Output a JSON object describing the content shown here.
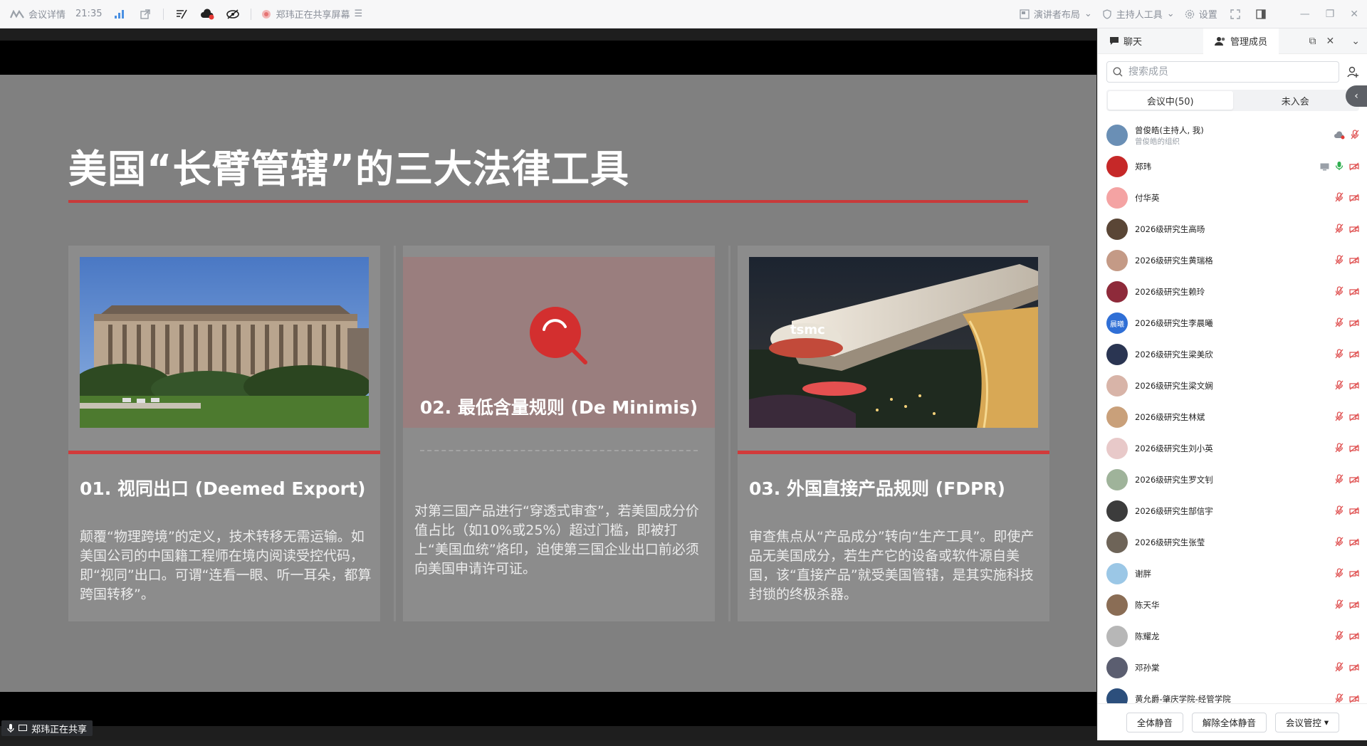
{
  "topbar": {
    "meeting_info_label": "会议详情",
    "time": "21:35",
    "sharing_status": "郑玮正在共享屏幕",
    "layout_label": "演讲者布局",
    "host_tools_label": "主持人工具",
    "settings_label": "设置"
  },
  "slide": {
    "title": "美国“长臂管辖”的三大法律工具",
    "cards": [
      {
        "title": "01. 视同出口 (Deemed Export)",
        "body": "颠覆“物理跨境”的定义，技术转移无需运输。如美国公司的中国籍工程师在境内阅读受控代码，即“视同”出口。可谓“连看一眼、听一耳朵，都算跨国转移”。"
      },
      {
        "title": "02. 最低含量规则 (De Minimis)",
        "body": "对第三国产品进行“穿透式审查”，若美国成分价值占比（如10%或25%）超过门槛，即被打上“美国血统”烙印，迫使第三国企业出口前必须向美国申请许可证。"
      },
      {
        "title": "03. 外国直接产品规则 (FDPR)",
        "body": "审查焦点从“产品成分”转向“生产工具”。即使产品无美国成分，若生产它的设备或软件源自美国，该“直接产品”就受美国管辖，是其实施科技封锁的终极杀器。"
      }
    ],
    "building_sign": "tsmc"
  },
  "share_tag": "郑玮正在共享",
  "panel": {
    "tab_chat": "聊天",
    "tab_members": "管理成员",
    "search_placeholder": "搜索成员",
    "seg_in_meeting": "会议中(50)",
    "seg_not_joined": "未入会",
    "members": [
      {
        "name": "曾俊皓(主持人, 我)",
        "sub": "曾俊皓的组织",
        "color": "#6a8fb5"
      },
      {
        "name": "郑玮",
        "color": "#c62828"
      },
      {
        "name": "付华英",
        "color": "#f4a3a3"
      },
      {
        "name": "2026级研究生高旸",
        "color": "#5a4636"
      },
      {
        "name": "2026级研究生黄瑞格",
        "color": "#c49a86"
      },
      {
        "name": "2026级研究生赖玲",
        "color": "#8e2a3a"
      },
      {
        "name": "2026级研究生李晨曦",
        "initials": "晨曦",
        "color": "#2f6fd6"
      },
      {
        "name": "2026级研究生梁美欣",
        "color": "#2a3552"
      },
      {
        "name": "2026级研究生梁文娴",
        "color": "#d8b4a8"
      },
      {
        "name": "2026级研究生林斌",
        "color": "#c9a07a"
      },
      {
        "name": "2026级研究生刘小英",
        "color": "#e8c9c9"
      },
      {
        "name": "2026级研究生罗文钊",
        "color": "#9fb39a"
      },
      {
        "name": "2026级研究生郜信宇",
        "color": "#3c3c3c"
      },
      {
        "name": "2026级研究生张莹",
        "color": "#6e6458"
      },
      {
        "name": "谢胖",
        "color": "#9bc7e6"
      },
      {
        "name": "陈天华",
        "color": "#8a6d55"
      },
      {
        "name": "陈耀龙",
        "color": "#b7b7b7"
      },
      {
        "name": "邓孙棠",
        "color": "#5b5e70"
      },
      {
        "name": "黄允爵-肇庆学院-经管学院",
        "color": "#2c4f7c"
      }
    ],
    "btn_mute_all": "全体静音",
    "btn_unmute_all": "解除全体静音",
    "btn_control": "会议管控"
  }
}
